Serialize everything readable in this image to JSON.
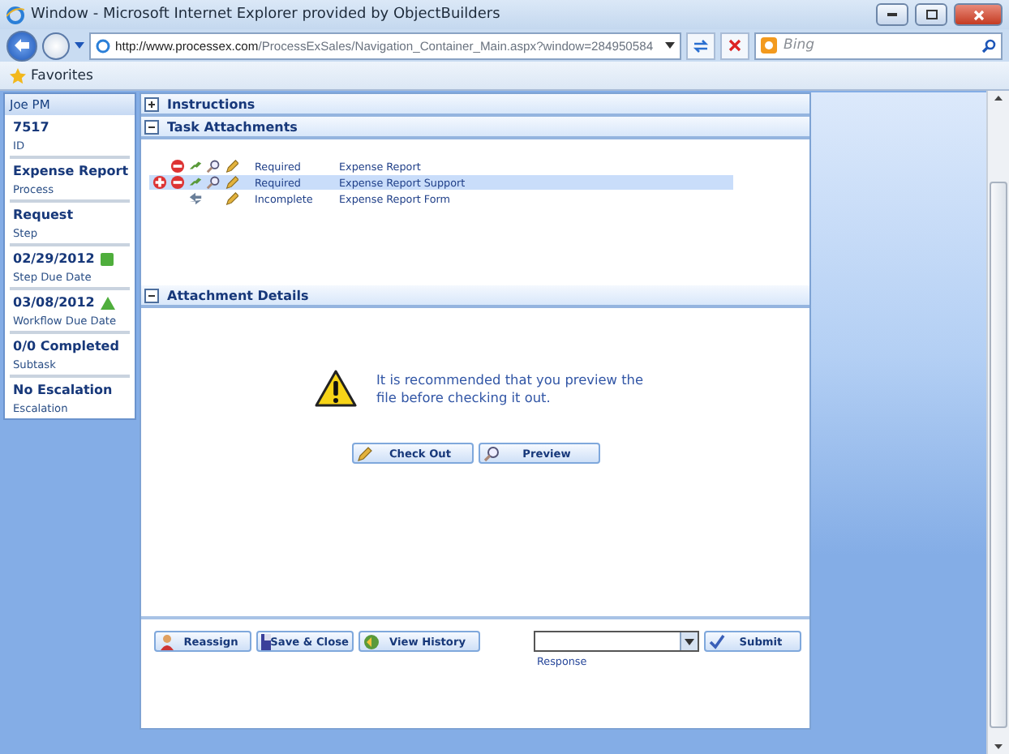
{
  "window": {
    "title": "Window - Microsoft Internet Explorer provided by ObjectBuilders"
  },
  "address_bar": {
    "url_host": "http://www.processex.com",
    "url_path": "/ProcessExSales/Navigation_Container_Main.aspx?window=284950584"
  },
  "search": {
    "placeholder": "Bing"
  },
  "favorites_bar": {
    "label": "Favorites"
  },
  "sidebar": {
    "user": "Joe PM",
    "items": [
      {
        "kind": "plain",
        "value": "7517",
        "label": "ID"
      },
      {
        "kind": "plain",
        "value": "Expense Report",
        "label": "Process"
      },
      {
        "kind": "plain",
        "value": "Request",
        "label": "Step"
      },
      {
        "kind": "square",
        "value": "02/29/2012",
        "label": "Step Due Date"
      },
      {
        "kind": "triangle",
        "value": "03/08/2012",
        "label": "Workflow Due Date"
      },
      {
        "kind": "plain",
        "value": "0/0 Completed",
        "label": "Subtask"
      },
      {
        "kind": "plain",
        "value": "No Escalation",
        "label": "Escalation"
      }
    ]
  },
  "sections": [
    {
      "title": "Instructions",
      "expanded": false
    },
    {
      "title": "Task Attachments",
      "expanded": true
    },
    {
      "title": "Attachment Details",
      "expanded": true
    }
  ],
  "attachments": [
    {
      "kind": "standard",
      "status": "Required",
      "name": "Expense Report",
      "selected": false
    },
    {
      "kind": "addable",
      "status": "Required",
      "name": "Expense Report Support",
      "selected": true
    },
    {
      "kind": "form",
      "status": "Incomplete",
      "name": "Expense Report Form",
      "selected": false
    }
  ],
  "details": {
    "message": "It is recommended that you preview the file before checking it out.",
    "buttons": [
      "Check Out",
      "Preview"
    ]
  },
  "actions": {
    "buttons": [
      "Reassign",
      "Save & Close",
      "View History"
    ],
    "response_label": "Response",
    "submit": "Submit"
  }
}
